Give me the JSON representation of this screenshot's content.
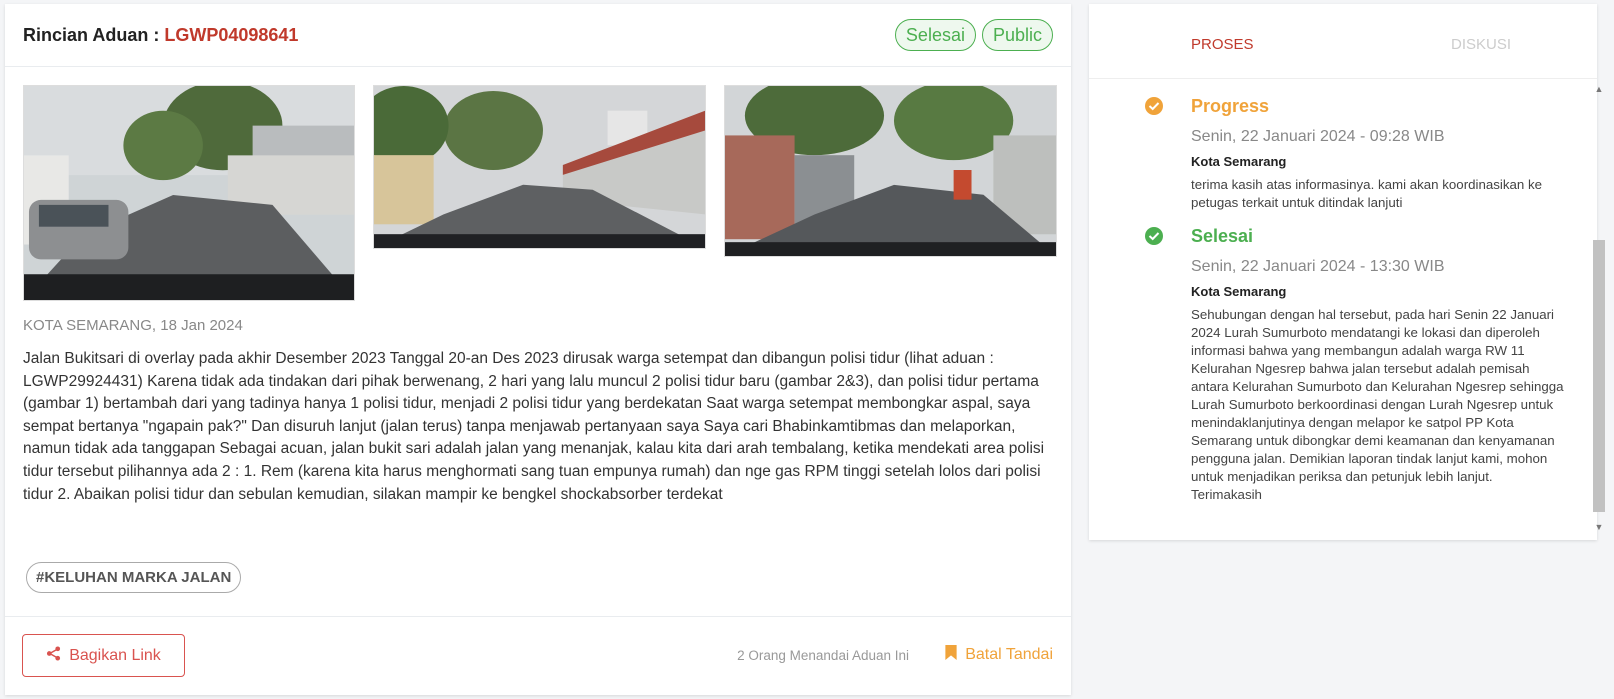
{
  "header": {
    "title_prefix": "Rincian Aduan : ",
    "code": "LGWP04098641",
    "badges": [
      "Selesai",
      "Public"
    ]
  },
  "report": {
    "location_date": "KOTA SEMARANG, 18 Jan 2024",
    "description": "Jalan Bukitsari di overlay pada akhir Desember 2023 Tanggal 20-an Des 2023 dirusak warga setempat dan dibangun polisi tidur (lihat aduan : LGWP29924431) Karena tidak ada tindakan dari pihak berwenang, 2 hari yang lalu muncul 2 polisi tidur baru (gambar 2&3), dan polisi tidur pertama (gambar 1) bertambah dari yang tadinya hanya 1 polisi tidur, menjadi 2 polisi tidur yang berdekatan Saat warga setempat membongkar aspal, saya sempat bertanya \"ngapain pak?\" Dan disuruh lanjut (jalan terus) tanpa menjawab pertanyaan saya Saya cari Bhabinkamtibmas dan melaporkan, namun tidak ada tanggapan Sebagai acuan, jalan bukit sari adalah jalan yang menanjak, kalau kita dari arah tembalang, ketika mendekati area polisi tidur tersebut pilihannya ada 2 : 1. Rem (karena kita harus menghormati sang tuan empunya rumah) dan nge gas RPM tinggi setelah lolos dari polisi tidur 2. Abaikan polisi tidur dan sebulan kemudian, silakan mampir ke bengkel shockabsorber terdekat",
    "tag": "#KELUHAN MARKA JALAN"
  },
  "footer": {
    "share_label": "Bagikan Link",
    "marker_count": "2 Orang Menandai Aduan Ini",
    "bookmark_label": "Batal Tandai"
  },
  "tabs": {
    "proses": "PROSES",
    "diskusi": "DISKUSI"
  },
  "timeline": [
    {
      "status": "Progress",
      "date": "Senin, 22 Januari 2024 - 09:28 WIB",
      "agency": "Kota Semarang",
      "message": "terima kasih atas informasinya. kami akan koordinasikan ke petugas terkait untuk ditindak lanjuti"
    },
    {
      "status": "Selesai",
      "date": "Senin, 22 Januari 2024 - 13:30 WIB",
      "agency": "Kota Semarang",
      "message": "Sehubungan dengan hal tersebut, pada hari Senin 22 Januari 2024 Lurah Sumurboto mendatangi ke lokasi dan diperoleh informasi bahwa yang membangun adalah warga RW 11 Kelurahan Ngesrep bahwa jalan tersebut adalah pemisah antara Kelurahan Sumurboto dan Kelurahan Ngesrep sehingga Lurah Sumurboto berkoordinasi dengan Lurah Ngesrep untuk menindaklanjutinya dengan melapor ke satpol PP Kota Semarang untuk dibongkar demi keamanan dan kenyamanan pengguna jalan. Demikian laporan tindak lanjut kami, mohon untuk menjadikan periksa dan petunjuk lebih lanjut. Terimakasih"
    }
  ],
  "colors": {
    "accent_red": "#c0392b",
    "success_green": "#4caf50",
    "progress_orange": "#f0a33a"
  },
  "icons": {
    "share": "share-icon",
    "bookmark": "bookmark-icon",
    "progress": "check-circle-icon",
    "done": "check-circle-icon"
  }
}
